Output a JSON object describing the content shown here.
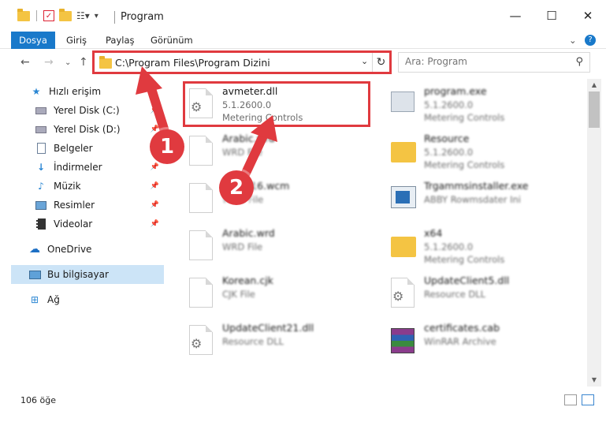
{
  "window": {
    "title": "Program",
    "minimize": "—",
    "maximize": "☐",
    "close": "✕"
  },
  "ribbon": {
    "tabs": [
      "Dosya",
      "Giriş",
      "Paylaş",
      "Görünüm"
    ],
    "expand": "⌄",
    "help": "?"
  },
  "nav": {
    "back": "←",
    "forward": "→",
    "recent": "⌄",
    "up": "↑",
    "address": "C:\\Program Files\\Program Dizini",
    "address_drop": "⌄",
    "refresh": "↻",
    "search_placeholder": "Ara: Program"
  },
  "sidebar": {
    "items": [
      {
        "label": "Hızlı erişim",
        "icon": "star-icon",
        "pinned": false
      },
      {
        "label": "Yerel Disk (C:)",
        "icon": "drive-icon",
        "pinned": true
      },
      {
        "label": "Yerel Disk (D:)",
        "icon": "drive-icon",
        "pinned": true
      },
      {
        "label": "Belgeler",
        "icon": "documents-icon",
        "pinned": true
      },
      {
        "label": "İndirmeler",
        "icon": "download-icon",
        "pinned": true
      },
      {
        "label": "Müzik",
        "icon": "music-icon",
        "pinned": true
      },
      {
        "label": "Resimler",
        "icon": "pictures-icon",
        "pinned": true
      },
      {
        "label": "Videolar",
        "icon": "videos-icon",
        "pinned": true
      },
      {
        "label": "OneDrive",
        "icon": "cloud-icon",
        "pinned": false
      },
      {
        "label": "Bu bilgisayar",
        "icon": "computer-icon",
        "pinned": false
      },
      {
        "label": "Ağ",
        "icon": "network-icon",
        "pinned": false
      }
    ]
  },
  "files": [
    {
      "name": "avmeter.dll",
      "meta1": "5.1.2600.0",
      "meta2": "Metering Controls",
      "icon": "dll-file-icon"
    },
    {
      "name": "program.exe",
      "meta1": "5.1.2600.0",
      "meta2": "Metering Controls",
      "icon": "exe-file-icon"
    },
    {
      "name": "Arabic.wrd",
      "meta1": "WRD File",
      "meta2": "",
      "icon": "file-icon"
    },
    {
      "name": "Resource",
      "meta1": "5.1.2600.0",
      "meta2": "Metering Controls",
      "icon": "folder-icon"
    },
    {
      "name": "AVWP16.wcm",
      "meta1": "WCM File",
      "meta2": "",
      "icon": "file-icon"
    },
    {
      "name": "Trgammsinstaller.exe",
      "meta1": "ABBY Rowmsdater Ini",
      "meta2": "",
      "icon": "installer-icon"
    },
    {
      "name": "Arabic.wrd",
      "meta1": "WRD File",
      "meta2": "",
      "icon": "file-icon"
    },
    {
      "name": "x64",
      "meta1": "5.1.2600.0",
      "meta2": "Metering Controls",
      "icon": "folder-icon"
    },
    {
      "name": "Korean.cjk",
      "meta1": "CJK File",
      "meta2": "",
      "icon": "file-icon"
    },
    {
      "name": "UpdateClient5.dll",
      "meta1": "Resource DLL",
      "meta2": "",
      "icon": "dll-file-icon"
    },
    {
      "name": "UpdateClient21.dll",
      "meta1": "Resource DLL",
      "meta2": "",
      "icon": "dll-file-icon"
    },
    {
      "name": "certificates.cab",
      "meta1": "WinRAR Archive",
      "meta2": "",
      "icon": "archive-icon"
    }
  ],
  "status": {
    "count": "106 öğe"
  },
  "annotations": {
    "step1": "1",
    "step2": "2",
    "accent": "#e03a3f"
  }
}
